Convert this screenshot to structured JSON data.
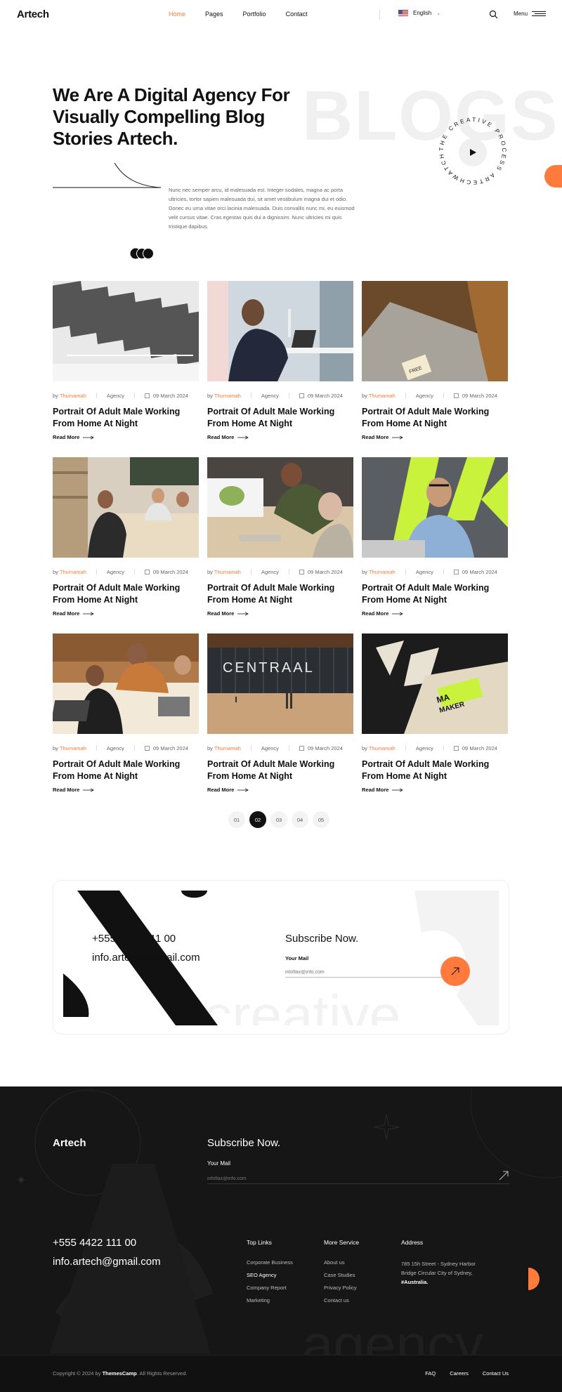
{
  "header": {
    "logo": "Artech",
    "nav": [
      "Home",
      "Pages",
      "Portfolio",
      "Contact"
    ],
    "language": "English",
    "menu_label": "Menu"
  },
  "hero": {
    "title": "We Are A Digital Agency For Visually Compelling Blog Stories Artech.",
    "bg_word": "BLOGS",
    "description": "Nunc nec semper arcu, id malesuada est. Integer sodales, magna ac porta ultricies, tortor sapien malesuada dui, sit amet vestibulum magna dui et odio. Donec eu urna vitae orci lacinia malesuada. Duis convallis nunc mi, eu euismod velit cursus vitae. Cras egestas quis dui a dignissim. Nunc ultricies mi quis tristique dapibus.",
    "badge_text": "THE CREATIVE PROCESS ARTECHWATCH"
  },
  "posts": [
    {
      "by": "by",
      "author": "Thumamah",
      "category": "Agency",
      "date": "09 March 2024",
      "title": "Portrait Of Adult Male Working From Home At Night",
      "read_more": "Read More",
      "image": "office-ceiling-panels"
    },
    {
      "by": "by",
      "author": "Thumamah",
      "category": "Agency",
      "date": "09 March 2024",
      "title": "Portrait Of Adult Male Working From Home At Night",
      "read_more": "Read More",
      "image": "man-headphones-laptop"
    },
    {
      "by": "by",
      "author": "Thumamah",
      "category": "Agency",
      "date": "09 March 2024",
      "title": "Portrait Of Adult Male Working From Home At Night",
      "read_more": "Read More",
      "image": "wooden-chair-bag"
    },
    {
      "by": "by",
      "author": "Thumamah",
      "category": "Agency",
      "date": "09 March 2024",
      "title": "Portrait Of Adult Male Working From Home At Night",
      "read_more": "Read More",
      "image": "team-meeting-table"
    },
    {
      "by": "by",
      "author": "Thumamah",
      "category": "Agency",
      "date": "09 March 2024",
      "title": "Portrait Of Adult Male Working From Home At Night",
      "read_more": "Read More",
      "image": "designers-at-desk"
    },
    {
      "by": "by",
      "author": "Thumamah",
      "category": "Agency",
      "date": "09 March 2024",
      "title": "Portrait Of Adult Male Working From Home At Night",
      "read_more": "Read More",
      "image": "man-glasses-laptop"
    },
    {
      "by": "by",
      "author": "Thumamah",
      "category": "Agency",
      "date": "09 March 2024",
      "title": "Portrait Of Adult Male Working From Home At Night",
      "read_more": "Read More",
      "image": "team-laptops"
    },
    {
      "by": "by",
      "author": "Thumamah",
      "category": "Agency",
      "date": "09 March 2024",
      "title": "Portrait Of Adult Male Working From Home At Night",
      "read_more": "Read More",
      "image": "centraal-station"
    },
    {
      "by": "by",
      "author": "Thumamah",
      "category": "Agency",
      "date": "09 March 2024",
      "title": "Portrait Of Adult Male Working From Home At Night",
      "read_more": "Read More",
      "image": "tote-bag-print"
    }
  ],
  "pagination": [
    "01",
    "02",
    "03",
    "04",
    "05"
  ],
  "pagination_active": 1,
  "contact": {
    "phone": "+555 4422 111 00",
    "email": "info.artech@gmail.com",
    "subscribe_title": "Subscribe Now.",
    "mail_label": "Your Mail",
    "mail_placeholder": "infoflax@info.com",
    "bg_word": "creative"
  },
  "footer": {
    "logo": "Artech",
    "subscribe_title": "Subscribe Now.",
    "mail_label": "Your Mail",
    "mail_placeholder": "infoflax@info.com",
    "phone": "+555 4422 111 00",
    "email": "info.artech@gmail.com",
    "top_links": {
      "title": "Top Links",
      "items": [
        "Corporate Business",
        "SEO Agency",
        "Company Report",
        "Marketing"
      ]
    },
    "more_service": {
      "title": "More Service",
      "items": [
        "About us",
        "Case Studies",
        "Privacy Policy",
        "Contact us"
      ]
    },
    "address": {
      "title": "Address",
      "line": "785 15h Street - Sydney Harbor Bridge Circular City of Sydney,",
      "country": "#Australia."
    },
    "bg_word": "agency",
    "copyright_prefix": "Copyright © 2024 by",
    "copyright_brand": "ThemesCamp",
    "copyright_suffix": ". All Rights Reserved.",
    "bottom_links": [
      "FAQ",
      "Careers",
      "Contact Us"
    ]
  },
  "colors": {
    "accent": "#ff7a3d",
    "dark": "#161616",
    "lime": "#c8f23c"
  }
}
